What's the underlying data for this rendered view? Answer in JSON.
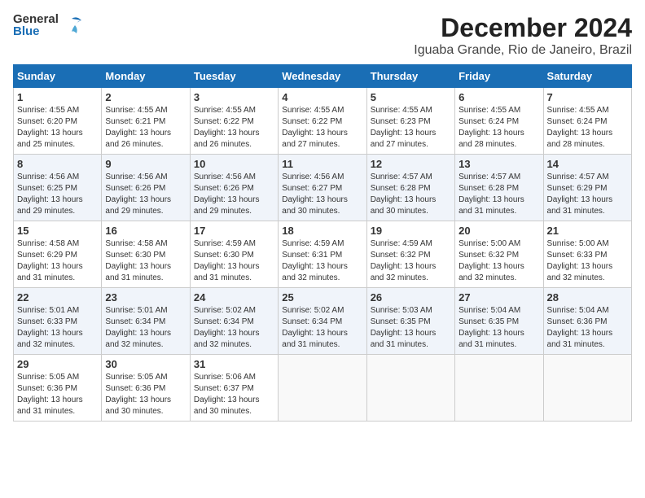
{
  "logo": {
    "line1": "General",
    "line2": "Blue"
  },
  "title": "December 2024",
  "location": "Iguaba Grande, Rio de Janeiro, Brazil",
  "weekdays": [
    "Sunday",
    "Monday",
    "Tuesday",
    "Wednesday",
    "Thursday",
    "Friday",
    "Saturday"
  ],
  "weeks": [
    [
      {
        "day": "1",
        "info": "Sunrise: 4:55 AM\nSunset: 6:20 PM\nDaylight: 13 hours\nand 25 minutes."
      },
      {
        "day": "2",
        "info": "Sunrise: 4:55 AM\nSunset: 6:21 PM\nDaylight: 13 hours\nand 26 minutes."
      },
      {
        "day": "3",
        "info": "Sunrise: 4:55 AM\nSunset: 6:22 PM\nDaylight: 13 hours\nand 26 minutes."
      },
      {
        "day": "4",
        "info": "Sunrise: 4:55 AM\nSunset: 6:22 PM\nDaylight: 13 hours\nand 27 minutes."
      },
      {
        "day": "5",
        "info": "Sunrise: 4:55 AM\nSunset: 6:23 PM\nDaylight: 13 hours\nand 27 minutes."
      },
      {
        "day": "6",
        "info": "Sunrise: 4:55 AM\nSunset: 6:24 PM\nDaylight: 13 hours\nand 28 minutes."
      },
      {
        "day": "7",
        "info": "Sunrise: 4:55 AM\nSunset: 6:24 PM\nDaylight: 13 hours\nand 28 minutes."
      }
    ],
    [
      {
        "day": "8",
        "info": "Sunrise: 4:56 AM\nSunset: 6:25 PM\nDaylight: 13 hours\nand 29 minutes."
      },
      {
        "day": "9",
        "info": "Sunrise: 4:56 AM\nSunset: 6:26 PM\nDaylight: 13 hours\nand 29 minutes."
      },
      {
        "day": "10",
        "info": "Sunrise: 4:56 AM\nSunset: 6:26 PM\nDaylight: 13 hours\nand 29 minutes."
      },
      {
        "day": "11",
        "info": "Sunrise: 4:56 AM\nSunset: 6:27 PM\nDaylight: 13 hours\nand 30 minutes."
      },
      {
        "day": "12",
        "info": "Sunrise: 4:57 AM\nSunset: 6:28 PM\nDaylight: 13 hours\nand 30 minutes."
      },
      {
        "day": "13",
        "info": "Sunrise: 4:57 AM\nSunset: 6:28 PM\nDaylight: 13 hours\nand 31 minutes."
      },
      {
        "day": "14",
        "info": "Sunrise: 4:57 AM\nSunset: 6:29 PM\nDaylight: 13 hours\nand 31 minutes."
      }
    ],
    [
      {
        "day": "15",
        "info": "Sunrise: 4:58 AM\nSunset: 6:29 PM\nDaylight: 13 hours\nand 31 minutes."
      },
      {
        "day": "16",
        "info": "Sunrise: 4:58 AM\nSunset: 6:30 PM\nDaylight: 13 hours\nand 31 minutes."
      },
      {
        "day": "17",
        "info": "Sunrise: 4:59 AM\nSunset: 6:30 PM\nDaylight: 13 hours\nand 31 minutes."
      },
      {
        "day": "18",
        "info": "Sunrise: 4:59 AM\nSunset: 6:31 PM\nDaylight: 13 hours\nand 32 minutes."
      },
      {
        "day": "19",
        "info": "Sunrise: 4:59 AM\nSunset: 6:32 PM\nDaylight: 13 hours\nand 32 minutes."
      },
      {
        "day": "20",
        "info": "Sunrise: 5:00 AM\nSunset: 6:32 PM\nDaylight: 13 hours\nand 32 minutes."
      },
      {
        "day": "21",
        "info": "Sunrise: 5:00 AM\nSunset: 6:33 PM\nDaylight: 13 hours\nand 32 minutes."
      }
    ],
    [
      {
        "day": "22",
        "info": "Sunrise: 5:01 AM\nSunset: 6:33 PM\nDaylight: 13 hours\nand 32 minutes."
      },
      {
        "day": "23",
        "info": "Sunrise: 5:01 AM\nSunset: 6:34 PM\nDaylight: 13 hours\nand 32 minutes."
      },
      {
        "day": "24",
        "info": "Sunrise: 5:02 AM\nSunset: 6:34 PM\nDaylight: 13 hours\nand 32 minutes."
      },
      {
        "day": "25",
        "info": "Sunrise: 5:02 AM\nSunset: 6:34 PM\nDaylight: 13 hours\nand 31 minutes."
      },
      {
        "day": "26",
        "info": "Sunrise: 5:03 AM\nSunset: 6:35 PM\nDaylight: 13 hours\nand 31 minutes."
      },
      {
        "day": "27",
        "info": "Sunrise: 5:04 AM\nSunset: 6:35 PM\nDaylight: 13 hours\nand 31 minutes."
      },
      {
        "day": "28",
        "info": "Sunrise: 5:04 AM\nSunset: 6:36 PM\nDaylight: 13 hours\nand 31 minutes."
      }
    ],
    [
      {
        "day": "29",
        "info": "Sunrise: 5:05 AM\nSunset: 6:36 PM\nDaylight: 13 hours\nand 31 minutes."
      },
      {
        "day": "30",
        "info": "Sunrise: 5:05 AM\nSunset: 6:36 PM\nDaylight: 13 hours\nand 30 minutes."
      },
      {
        "day": "31",
        "info": "Sunrise: 5:06 AM\nSunset: 6:37 PM\nDaylight: 13 hours\nand 30 minutes."
      },
      {
        "day": "",
        "info": ""
      },
      {
        "day": "",
        "info": ""
      },
      {
        "day": "",
        "info": ""
      },
      {
        "day": "",
        "info": ""
      }
    ]
  ]
}
